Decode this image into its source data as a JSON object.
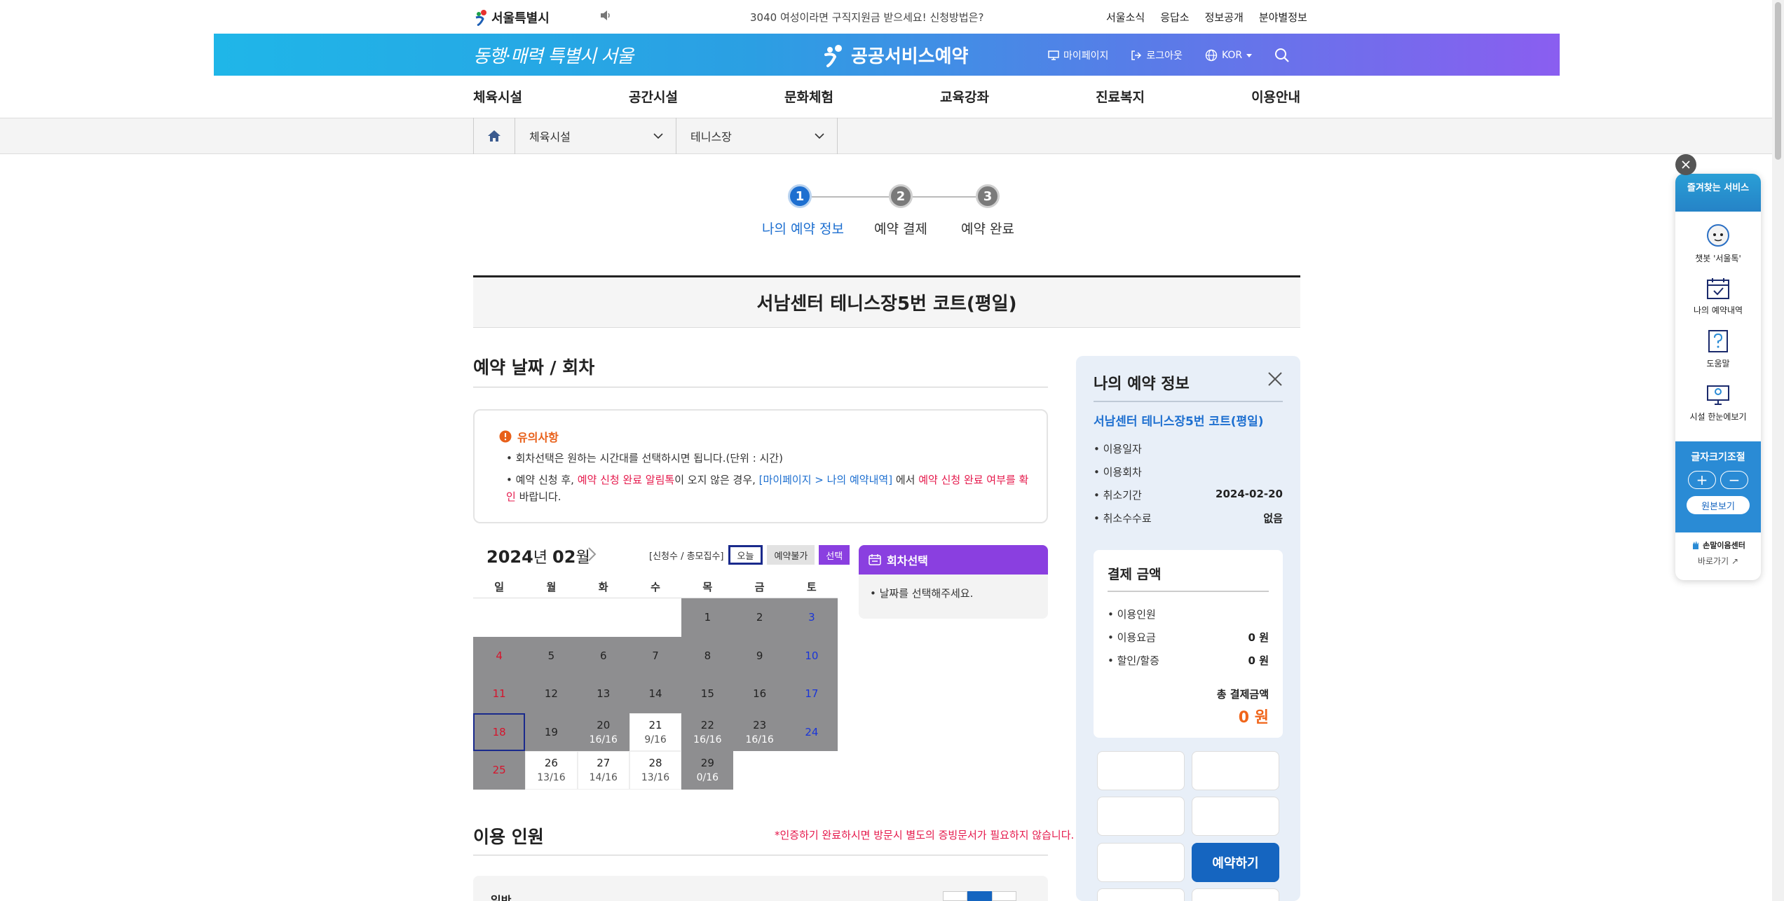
{
  "topbar": {
    "logo": "서울특별시",
    "notice": "3040 여성이라면 구직지원금 받으세요! 신청방법은?",
    "links": [
      "서울소식",
      "응답소",
      "정보공개",
      "분야별정보"
    ]
  },
  "banner": {
    "slogan": "동행·매력 특별시 서울",
    "brand": "공공서비스예약",
    "mypage": "마이페이지",
    "logout": "로그아웃",
    "lang": "KOR"
  },
  "nav": [
    "체육시설",
    "공간시설",
    "문화체험",
    "교육강좌",
    "진료복지",
    "이용안내"
  ],
  "breadcrumb": {
    "level1": "체육시설",
    "level2": "테니스장"
  },
  "steps": [
    {
      "num": "1",
      "label": "나의 예약 정보"
    },
    {
      "num": "2",
      "label": "예약 결제"
    },
    {
      "num": "3",
      "label": "예약 완료"
    }
  ],
  "facility_title": "서남센터 테니스장5번 코트(평일)",
  "section_date": "예약 날짜 / 회차",
  "caution": {
    "title": "유의사항",
    "line1": "회차선택은 원하는 시간대를 선택하시면 됩니다.(단위 : 시간)",
    "line2_a": "예약 신청 후, ",
    "line2_b": "예약 신청 완료 알림톡",
    "line2_c": "이 오지 않은 경우, ",
    "line2_d": "[마이페이지 > 나의 예약내역]",
    "line2_e": " 에서 ",
    "line2_f": "예약 신청 완료 여부를 확인",
    "line2_g": " 바랍니다."
  },
  "calendar": {
    "year": "2024",
    "year_suffix": "년",
    "month": "02",
    "month_suffix": "월",
    "legend_text": "[신청수 / 총모집수]",
    "legend_today": "오늘",
    "legend_unavailable": "예약불가",
    "legend_select": "선택",
    "weekdays": [
      "일",
      "월",
      "화",
      "수",
      "목",
      "금",
      "토"
    ],
    "weeks": [
      [
        {
          "d": "",
          "s": "empty"
        },
        {
          "d": "",
          "s": "empty"
        },
        {
          "d": "",
          "s": "empty"
        },
        {
          "d": "",
          "s": "empty"
        },
        {
          "d": "1",
          "s": "gray"
        },
        {
          "d": "2",
          "s": "gray"
        },
        {
          "d": "3",
          "s": "gray"
        }
      ],
      [
        {
          "d": "4",
          "s": "gray"
        },
        {
          "d": "5",
          "s": "gray"
        },
        {
          "d": "6",
          "s": "gray"
        },
        {
          "d": "7",
          "s": "gray"
        },
        {
          "d": "8",
          "s": "gray"
        },
        {
          "d": "9",
          "s": "gray"
        },
        {
          "d": "10",
          "s": "gray"
        }
      ],
      [
        {
          "d": "11",
          "s": "gray"
        },
        {
          "d": "12",
          "s": "gray"
        },
        {
          "d": "13",
          "s": "gray"
        },
        {
          "d": "14",
          "s": "gray"
        },
        {
          "d": "15",
          "s": "gray"
        },
        {
          "d": "16",
          "s": "gray"
        },
        {
          "d": "17",
          "s": "gray"
        }
      ],
      [
        {
          "d": "18",
          "s": "gray",
          "today": true
        },
        {
          "d": "19",
          "s": "gray"
        },
        {
          "d": "20",
          "s": "gray",
          "c": "16/16"
        },
        {
          "d": "21",
          "s": "white",
          "c": "9/16"
        },
        {
          "d": "22",
          "s": "gray",
          "c": "16/16"
        },
        {
          "d": "23",
          "s": "gray",
          "c": "16/16"
        },
        {
          "d": "24",
          "s": "gray"
        }
      ],
      [
        {
          "d": "25",
          "s": "gray"
        },
        {
          "d": "26",
          "s": "white",
          "c": "13/16"
        },
        {
          "d": "27",
          "s": "white",
          "c": "14/16"
        },
        {
          "d": "28",
          "s": "white",
          "c": "13/16"
        },
        {
          "d": "29",
          "s": "gray",
          "c": "0/16"
        },
        {
          "d": "",
          "s": "empty"
        },
        {
          "d": "",
          "s": "empty"
        }
      ]
    ]
  },
  "round": {
    "title": "회차선택",
    "message": "날짜를 선택해주세요."
  },
  "people": {
    "title": "이용 인원",
    "note": "*인증하기 완료하시면 방문시 별도의 증빙문서가 필요하지 않습니다.",
    "row_label": "일반"
  },
  "info": {
    "title": "나의 예약 정보",
    "facility": "서남센터 테니스장5번 코트(평일)",
    "rows": [
      {
        "k": "이용일자",
        "v": ""
      },
      {
        "k": "이용회차",
        "v": ""
      },
      {
        "k": "취소기간",
        "v": "2024-02-20"
      },
      {
        "k": "취소수수료",
        "v": "없음"
      }
    ],
    "pay_title": "결제 금액",
    "pay_rows": [
      {
        "k": "이용인원",
        "v": ""
      },
      {
        "k": "이용요금",
        "v": "0 원"
      },
      {
        "k": "할인/할증",
        "v": "0 원"
      }
    ],
    "total_label": "총 결제금액",
    "total_value": "0 원",
    "reserve_btn": "예약하기"
  },
  "quickmenu": {
    "head": "즐겨찾는 서비스",
    "items": [
      "챗봇 '서울톡'",
      "나의 예약내역",
      "도움말",
      "시설 한눈에보기"
    ],
    "font_title": "글자크기조절",
    "font_plus": "+",
    "font_minus": "−",
    "orig": "원본보기",
    "sign_center": "손말이음센터",
    "go": "바로가기"
  },
  "colors": {
    "accent_blue": "#1d6fd0",
    "purple": "#8a3fe0",
    "orange": "#f0651a",
    "red": "#e5184b",
    "cal_gray": "#8e8e90"
  }
}
